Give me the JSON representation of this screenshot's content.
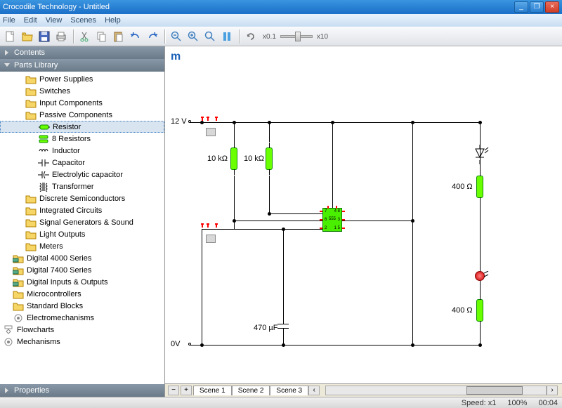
{
  "window": {
    "title": "Crocodile Technology - Untitled"
  },
  "menu": [
    "File",
    "Edit",
    "View",
    "Scenes",
    "Help"
  ],
  "toolbar": {
    "new": "New",
    "open": "Open",
    "save": "Save",
    "print": "Print",
    "cut": "Cut",
    "copy": "Copy",
    "paste": "Paste",
    "undo": "Undo",
    "redo": "Redo",
    "zoom_out": "Zoom Out",
    "zoom_in": "Zoom In",
    "zoom_tool": "Zoom Tool",
    "pause": "Pause",
    "rotate": "Rotate",
    "speed_min": "x0.1",
    "speed_max": "x10"
  },
  "panels": {
    "contents": "Contents",
    "parts": "Parts Library",
    "properties": "Properties"
  },
  "tree": [
    {
      "d": 2,
      "kind": "folder",
      "label": "Power Supplies"
    },
    {
      "d": 2,
      "kind": "folder",
      "label": "Switches"
    },
    {
      "d": 2,
      "kind": "folder",
      "label": "Input Components"
    },
    {
      "d": 2,
      "kind": "folder",
      "label": "Passive Components"
    },
    {
      "d": 3,
      "kind": "resistor",
      "label": "Resistor",
      "sel": true
    },
    {
      "d": 3,
      "kind": "resistor8",
      "label": "8 Resistors"
    },
    {
      "d": 3,
      "kind": "inductor",
      "label": "Inductor"
    },
    {
      "d": 3,
      "kind": "cap",
      "label": "Capacitor"
    },
    {
      "d": 3,
      "kind": "ecap",
      "label": "Electrolytic capacitor"
    },
    {
      "d": 3,
      "kind": "xfmr",
      "label": "Transformer"
    },
    {
      "d": 2,
      "kind": "folder",
      "label": "Discrete Semiconductors"
    },
    {
      "d": 2,
      "kind": "folder",
      "label": "Integrated Circuits"
    },
    {
      "d": 2,
      "kind": "folder",
      "label": "Signal Generators & Sound"
    },
    {
      "d": 2,
      "kind": "folder",
      "label": "Light Outputs"
    },
    {
      "d": 2,
      "kind": "folder",
      "label": "Meters"
    },
    {
      "d": 1,
      "kind": "folder-g",
      "label": "Digital 4000 Series"
    },
    {
      "d": 1,
      "kind": "folder-g",
      "label": "Digital 7400 Series"
    },
    {
      "d": 1,
      "kind": "folder-g",
      "label": "Digital Inputs & Outputs"
    },
    {
      "d": 1,
      "kind": "folder",
      "label": "Microcontrollers"
    },
    {
      "d": 1,
      "kind": "folder",
      "label": "Standard Blocks"
    },
    {
      "d": 1,
      "kind": "mech",
      "label": "Electromechanisms"
    },
    {
      "d": 0,
      "kind": "flow",
      "label": "Flowcharts"
    },
    {
      "d": 0,
      "kind": "mech",
      "label": "Mechanisms"
    }
  ],
  "circuit": {
    "rail_top": "12 V",
    "rail_bot": "0V",
    "r1": "10 kΩ",
    "r2": "10 kΩ",
    "r3": "400 Ω",
    "r4": "400 Ω",
    "c1": "470 µF",
    "ic": {
      "name": "555",
      "pins_left": [
        "7",
        "6",
        "2"
      ],
      "pins_right": [
        "4  8",
        "3",
        "1  5"
      ]
    }
  },
  "scenes": {
    "tabs": [
      "Scene 1",
      "Scene 2",
      "Scene 3"
    ]
  },
  "status": {
    "speed": "Speed: x1",
    "zoom": "100%",
    "time": "00:04"
  }
}
